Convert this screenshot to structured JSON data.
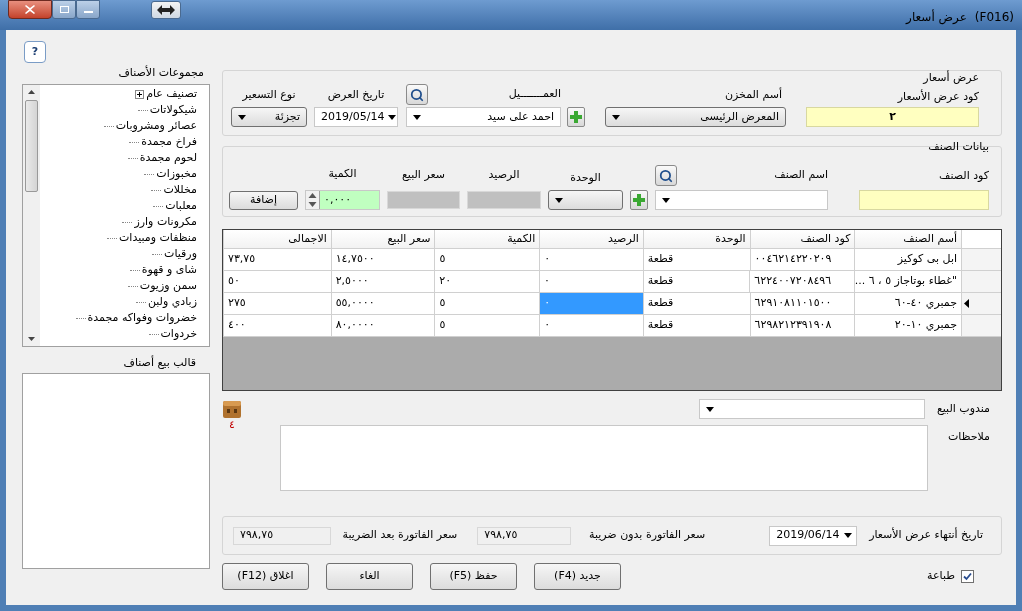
{
  "window": {
    "title": "عرض أسعار",
    "code": "(F016)"
  },
  "help_button": "?",
  "categories_panel": {
    "title": "مجموعات الأصناف",
    "tree": [
      {
        "label": "تصنيف عام",
        "kind": "group"
      },
      {
        "label": "شيكولاتات",
        "kind": "leaf"
      },
      {
        "label": "عصائر ومشروبات",
        "kind": "leaf"
      },
      {
        "label": "فراخ مجمدة",
        "kind": "leaf"
      },
      {
        "label": "لحوم مجمدة",
        "kind": "leaf"
      },
      {
        "label": "مخبوزات",
        "kind": "leaf"
      },
      {
        "label": "مخللات",
        "kind": "leaf"
      },
      {
        "label": "معلبات",
        "kind": "leaf"
      },
      {
        "label": "مكرونات وارز",
        "kind": "leaf"
      },
      {
        "label": "منظفات ومبيدات",
        "kind": "leaf"
      },
      {
        "label": "ورقيات",
        "kind": "leaf"
      },
      {
        "label": "شاى و قهوة",
        "kind": "leaf"
      },
      {
        "label": "سمن وزيوت",
        "kind": "leaf"
      },
      {
        "label": "زبادي ولبن",
        "kind": "leaf"
      },
      {
        "label": "خضروات وفواكه مجمدة",
        "kind": "leaf"
      },
      {
        "label": "خردوات",
        "kind": "leaf"
      }
    ]
  },
  "template_panel": {
    "title": "قالب بيع أصناف"
  },
  "quote_group": {
    "title": "عرض أسعار",
    "code_label": "كود عرض الأسعار",
    "code_value": "٢",
    "warehouse_label": "أسم المخزن",
    "warehouse_value": "المعرض الرئيسى",
    "customer_label": "العمـــــــيل",
    "customer_value": "احمد على سيد",
    "date_label": "تاريخ العرض",
    "date_value": "2019/05/14",
    "pricing_label": "نوع التسعير",
    "pricing_value": "تجزئة"
  },
  "item_group": {
    "title": "بيانات الصنف",
    "code_label": "كود الصنف",
    "name_label": "اسم الصنف",
    "unit_label": "الوحدة",
    "balance_label": "الرصيد",
    "price_label": "سعر البيع",
    "qty_label": "الكمية",
    "qty_value": "٠,٠٠٠",
    "add_button": "إضافة"
  },
  "grid": {
    "columns": [
      "أسم الصنف",
      "كود الصنف",
      "الوحدة",
      "الرصيد",
      "الكمية",
      "سعر البيع",
      "الاجمالى"
    ],
    "rows": [
      {
        "selected": false,
        "cells": [
          {
            "text": "ابل بى كوكيز",
            "selected": false
          },
          {
            "text": "٠٠٤٦٢١٤٢٢٠٢٠٩",
            "selected": false
          },
          {
            "text": "قطعة",
            "selected": false
          },
          {
            "text": "٠",
            "selected": false
          },
          {
            "text": "٥",
            "selected": false
          },
          {
            "text": "١٤,٧٥٠٠",
            "selected": false
          },
          {
            "text": "٧٣,٧٥",
            "selected": false
          }
        ]
      },
      {
        "selected": false,
        "cells": [
          {
            "text": "\"غطاء بوتاجاز ٥ ، ٦ ...",
            "selected": false
          },
          {
            "text": "٦٢٢٤٠٠٧٢٠٨٤٩٦",
            "selected": false
          },
          {
            "text": "قطعة",
            "selected": false
          },
          {
            "text": "٠",
            "selected": false
          },
          {
            "text": "٢٠",
            "selected": false
          },
          {
            "text": "٢,٥٠٠٠",
            "selected": false
          },
          {
            "text": "٥٠",
            "selected": false
          }
        ]
      },
      {
        "selected": true,
        "cells": [
          {
            "text": "جمبري ٤٠-٦٠",
            "selected": false
          },
          {
            "text": "٦٢٩١٠٨١١٠١٥٠٠",
            "selected": false
          },
          {
            "text": "قطعة",
            "selected": false
          },
          {
            "text": "٠",
            "selected": true
          },
          {
            "text": "٥",
            "selected": false
          },
          {
            "text": "٥٥,٠٠٠٠",
            "selected": false
          },
          {
            "text": "٢٧٥",
            "selected": false
          }
        ]
      },
      {
        "selected": false,
        "cells": [
          {
            "text": "جمبري ١٠-٢٠",
            "selected": false
          },
          {
            "text": "٦٢٩٨٢١٢٣٩١٩٠٨",
            "selected": false
          },
          {
            "text": "قطعة",
            "selected": false
          },
          {
            "text": "٠",
            "selected": false
          },
          {
            "text": "٥",
            "selected": false
          },
          {
            "text": "٨٠,٠٠٠٠",
            "selected": false
          },
          {
            "text": "٤٠٠",
            "selected": false
          }
        ]
      }
    ]
  },
  "sales_rep_label": "مندوب البيع",
  "attachments_count": "٤",
  "notes_label": "ملاحظات",
  "footer": {
    "expiry_label": "تاريخ أنتهاء عرض الأسعار",
    "expiry_value": "2019/06/14",
    "net_label": "سعر الفاتورة  بدون ضريبة",
    "net_value": "٧٩٨,٧٥",
    "gross_label": "سعر الفاتورة  بعد الضريبة",
    "gross_value": "٧٩٨,٧٥"
  },
  "print": {
    "label": "طباعة",
    "checked": true
  },
  "buttons": [
    "جديد (F4)",
    "حفظ (F5)",
    "الغاء",
    "اغلاق (F12)"
  ]
}
